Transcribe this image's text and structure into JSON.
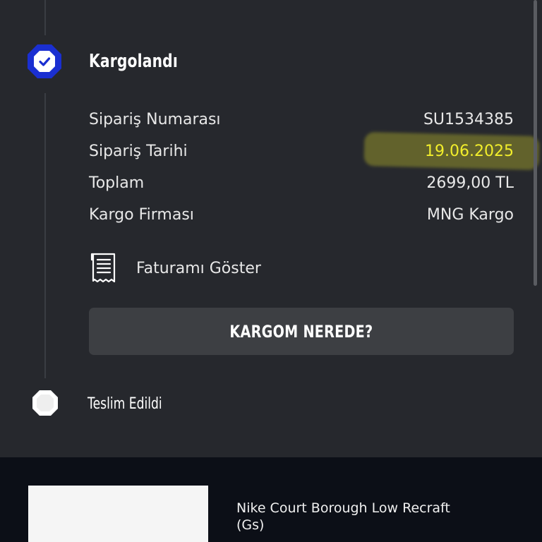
{
  "timeline": {
    "shipped": {
      "title": "Kargolandı",
      "status": "completed",
      "icon": "check-icon"
    },
    "delivered": {
      "title": "Teslim Edildi",
      "status": "pending",
      "icon": "empty-octagon-icon"
    }
  },
  "order_details": {
    "rows": [
      {
        "label": "Sipariş Numarası",
        "value": "SU1534385"
      },
      {
        "label": "Sipariş Tarihi",
        "value": "19.06.2025"
      },
      {
        "label": "Toplam",
        "value": "2699,00 TL"
      },
      {
        "label": "Kargo Firması",
        "value": "MNG Kargo"
      }
    ]
  },
  "invoice": {
    "label": "Faturamı Göster",
    "icon": "receipt-icon"
  },
  "track_button": {
    "label": "KARGOM NEREDE?"
  },
  "product": {
    "name": "Nike Court Borough Low Recraft (Gs)"
  },
  "colors": {
    "background": "#26282d",
    "accent_blue": "#1a2fd1",
    "highlight_yellow": "#f2ee2b",
    "button_bg": "#3d3f43",
    "product_section_bg": "#0c0f17"
  }
}
